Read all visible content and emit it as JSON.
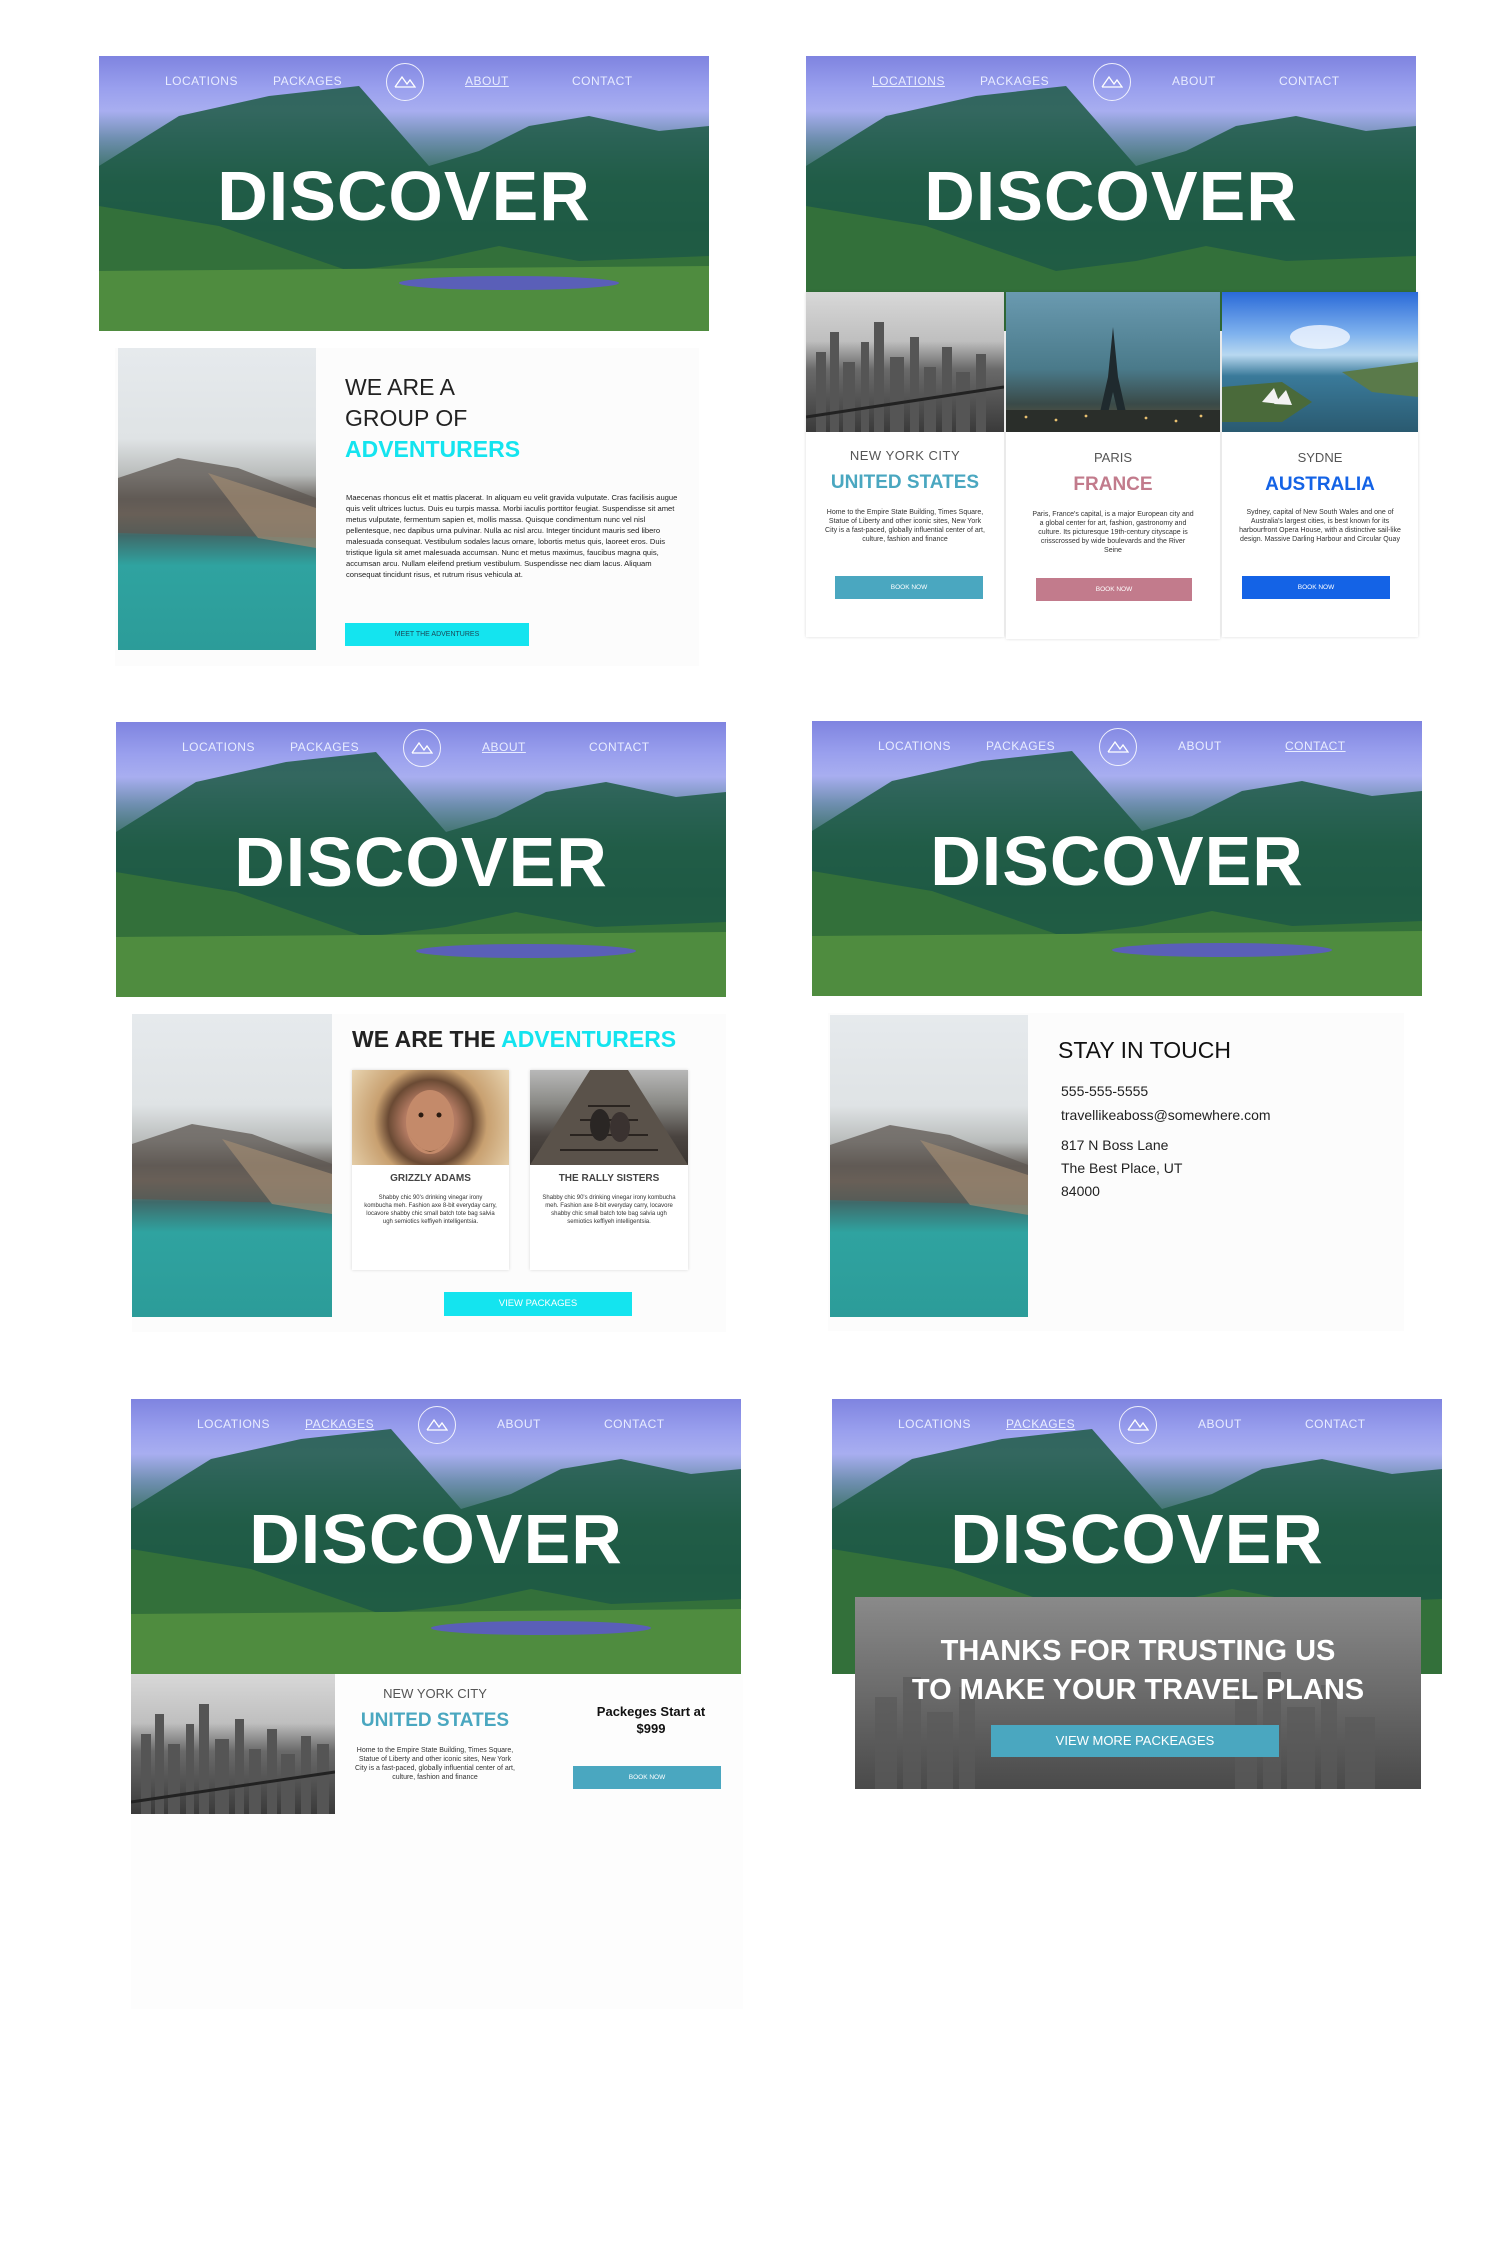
{
  "nav": {
    "locations": "LOCATIONS",
    "packages": "PACKAGES",
    "about": "ABOUT",
    "contact": "CONTACT"
  },
  "hero_title": "DISCOVER",
  "about": {
    "line1": "WE ARE A",
    "line2": "GROUP OF",
    "line3": "ADVENTURERS",
    "body": "Maecenas rhoncus elit et mattis placerat. In aliquam eu velit gravida vulputate. Cras facilisis augue quis velit ultrices luctus. Duis eu turpis massa. Morbi iaculis porttitor feugiat. Suspendisse sit amet metus vulputate, fermentum sapien et, mollis massa. Quisque condimentum nunc vel nisl pellentesque, nec dapibus urna pulvinar. Nulla ac nisl arcu. Integer tincidunt mauris sed libero malesuada consequat. Vestibulum sodales lacus ornare, lobortis metus quis, laoreet eros. Duis tristique ligula sit amet malesuada accumsan. Nunc et metus maximus, faucibus magna quis, accumsan arcu. Nullam eleifend pretium vestibulum. Suspendisse nec diam lacus. Aliquam consequat tincidunt risus, et rutrum risus vehicula at.",
    "button": "MEET THE ADVENTURES"
  },
  "locations": [
    {
      "city": "NEW YORK CITY",
      "country": "UNITED STATES",
      "color": "#4aa7c0",
      "desc": "Home to the Empire State Building, Times Square, Statue of Liberty and other iconic sites, New York City is a fast-paced, globally influential center of art, culture, fashion and finance",
      "button": "BOOK NOW"
    },
    {
      "city": "PARIS",
      "country": "FRANCE",
      "color": "#c27b8c",
      "desc": "Paris, France's capital, is a major European city and a global center for art, fashion, gastronomy and culture. Its picturesque 19th-century cityscape is crisscrossed by wide boulevards and the River Seine",
      "button": "BOOK NOW"
    },
    {
      "city": "SYDNE",
      "country": "AUSTRALIA",
      "color": "#1463e6",
      "desc": "Sydney, capital of New South Wales and one of Australia's largest cities, is best known for its harbourfront Opera House, with a distinctive sail-like design. Massive Darling Harbour and Circular Quay",
      "button": "BOOK NOW"
    }
  ],
  "team": {
    "title_a": "WE ARE THE ",
    "title_b": "ADVENTURERS",
    "members": [
      {
        "name": "GRIZZLY ADAMS",
        "desc": "Shabby chic 90's drinking vinegar irony kombucha meh. Fashion axe 8-bit everyday carry, locavore shabby chic small batch tote bag salvia ugh semiotics keffiyeh intelligentsia."
      },
      {
        "name": "THE RALLY SISTERS",
        "desc": "Shabby chic 90's drinking vinegar irony kombucha meh. Fashion axe 8-bit everyday carry, locavore shabby chic small batch tote bag salvia ugh semiotics keffiyeh intelligentsia."
      }
    ],
    "button": "VIEW PACKAGES"
  },
  "contact": {
    "title": "STAY IN TOUCH",
    "phone": "555-555-5555",
    "email": "travellikeaboss@somewhere.com",
    "addr1": "817 N Boss Lane",
    "addr2": "The Best Place, UT",
    "zip": "84000"
  },
  "package": {
    "city": "NEW YORK CITY",
    "country": "UNITED STATES",
    "desc": "Home to the Empire State Building, Times Square, Statue of Liberty and other iconic sites, New York City is a fast-paced, globally influential center of art, culture, fashion and finance",
    "price_label": "Packeges Start at",
    "price": "$999",
    "button": "BOOK NOW"
  },
  "thanks": {
    "line1": "THANKS FOR TRUSTING US",
    "line2": "TO MAKE YOUR TRAVEL PLANS",
    "button": "VIEW MORE PACKEAGES"
  },
  "colors": {
    "cyan": "#14e4ef",
    "teal": "#4aa7c0",
    "rose": "#c27b8c",
    "blue": "#1463e6"
  }
}
